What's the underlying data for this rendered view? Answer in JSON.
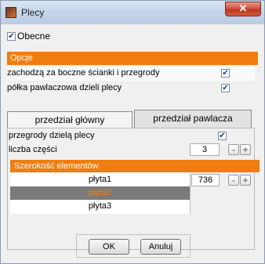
{
  "window": {
    "title": "Plecy",
    "close_glyph": "✕",
    "app_icon": "app-icon"
  },
  "obecne": {
    "label": "Obecne",
    "checked": true
  },
  "opcje": {
    "header": "Opcje",
    "rows": [
      {
        "label": "zachodzą za boczne ścianki i przegrody",
        "checked": true
      },
      {
        "label": "półka pawlaczowa dzieli plecy",
        "checked": true
      }
    ]
  },
  "tabs": [
    {
      "label": "przedział główny",
      "active": false
    },
    {
      "label": "przedział pawlacza",
      "active": true
    }
  ],
  "section": {
    "przegrody_label": "przegrody dzielą plecy",
    "przegrody_checked": true,
    "liczba_label": "liczba części",
    "liczba_value": "3",
    "minus": "-",
    "plus": "+"
  },
  "szerokosc": {
    "header": "Szerokość elementów",
    "items": [
      "płyta1",
      "płyta2",
      "płyta3"
    ],
    "selected_index": 1,
    "value": "736"
  },
  "buttons": {
    "ok": "OK",
    "cancel": "Anuluj"
  },
  "colors": {
    "accent": "#f07d0f",
    "selected_row": "#7a7a7a",
    "selected_text": "#f07d0f"
  }
}
